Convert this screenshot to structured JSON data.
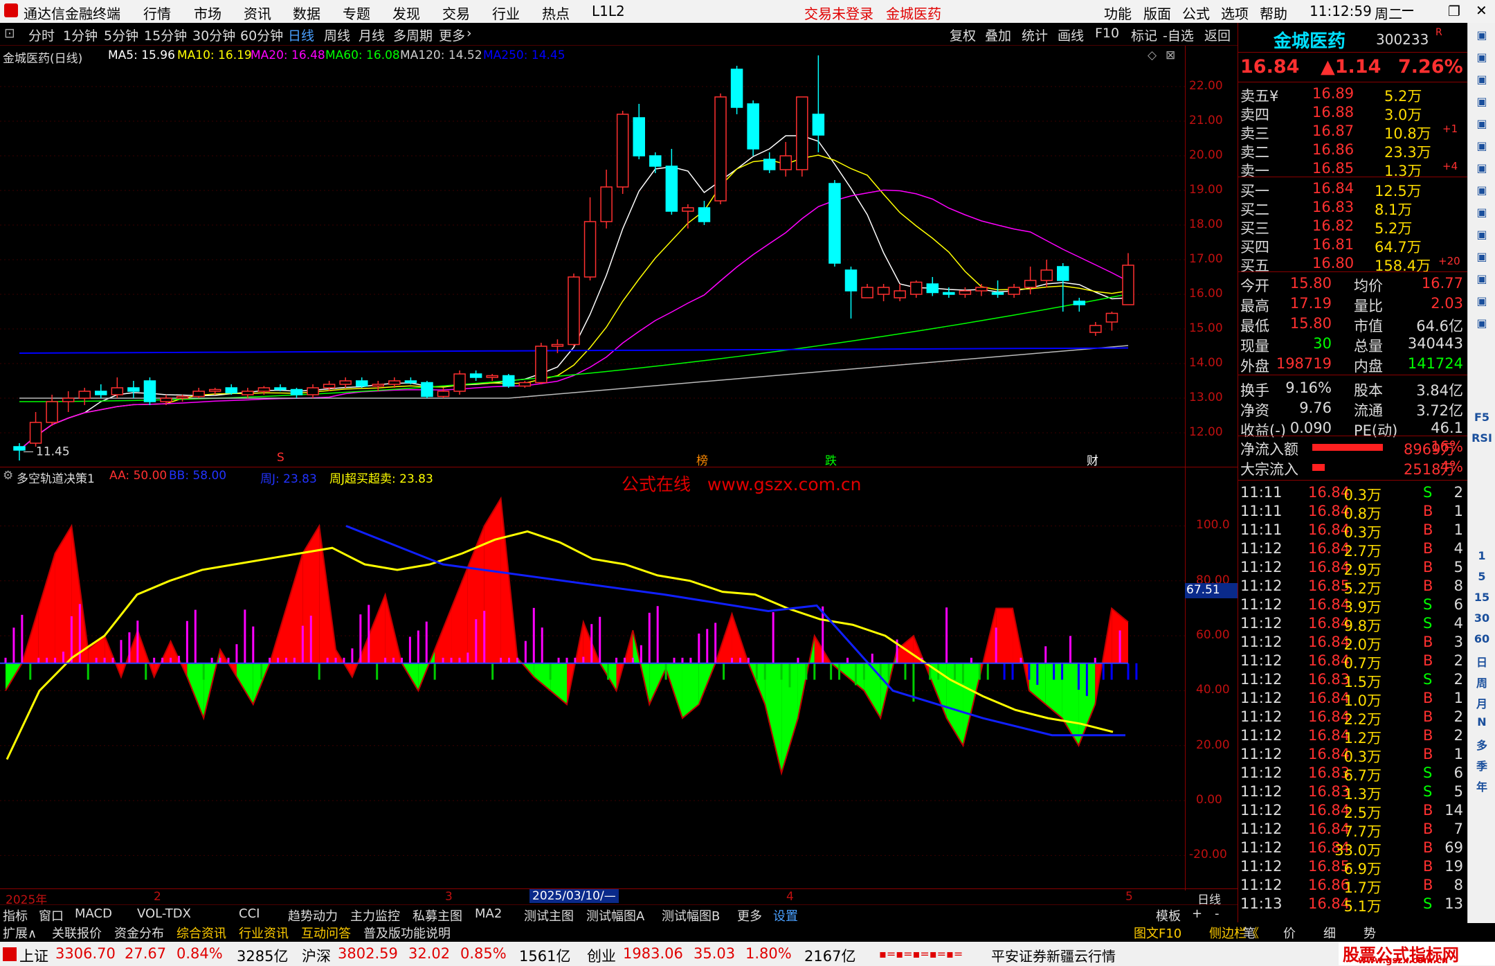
{
  "app": {
    "title": "通达信金融终端",
    "trade_status": "交易未登录",
    "stock_title": "金城医药",
    "func_menu": [
      "功能",
      "版面",
      "公式",
      "选项",
      "帮助"
    ],
    "clock": "11:12:59",
    "weekday": "周二"
  },
  "menu": [
    "行情",
    "市场",
    "资讯",
    "数据",
    "专题",
    "发现",
    "交易",
    "行业",
    "热点",
    "L1L2"
  ],
  "toolbar": {
    "periods": [
      "分时",
      "1分钟",
      "5分钟",
      "15分钟",
      "30分钟",
      "60分钟",
      "日线",
      "周线",
      "月线",
      "多周期",
      "更多"
    ],
    "active": "日线",
    "right": [
      "复权",
      "叠加",
      "统计",
      "画线",
      "F10",
      "标记",
      "-自选",
      "返回"
    ]
  },
  "ma_line": {
    "name": "金城医药(日线)",
    "items": [
      {
        "label": "MA5: 15.96",
        "color": "#ffffff"
      },
      {
        "label": "MA10: 16.19",
        "color": "#ffff00"
      },
      {
        "label": "MA20: 16.48",
        "color": "#ff00ff"
      },
      {
        "label": "MA60: 16.08",
        "color": "#00ff00"
      },
      {
        "label": "MA120: 14.52",
        "color": "#cccccc"
      },
      {
        "label": "MA250: 14.45",
        "color": "#0000ff"
      }
    ]
  },
  "price_axis": [
    "22.00",
    "21.00",
    "20.00",
    "19.00",
    "18.00",
    "17.00",
    "16.00",
    "15.00",
    "14.00",
    "13.00",
    "12.00"
  ],
  "price_marks": {
    "high": "23.22",
    "low": "11.45"
  },
  "event_marks": [
    {
      "t": "S",
      "color": "#ff3030"
    },
    {
      "t": "榜",
      "color": "#ff8a00"
    },
    {
      "t": "跌",
      "color": "#00ff00"
    },
    {
      "t": "财",
      "color": "#ffffff"
    }
  ],
  "indicator": {
    "name": "多空轨道决策1",
    "items": [
      {
        "label": "AA: 50.00",
        "color": "#ff3030"
      },
      {
        "label": "BB: 58.00",
        "color": "#0000ff"
      },
      {
        "label": "周J: 23.83",
        "color": "#0000ff"
      },
      {
        "label": "周J超买超卖: 23.83",
        "color": "#ffff00"
      }
    ],
    "watermark": "公式在线   www.gszx.com.cn",
    "axis": [
      "100.0",
      "80.00",
      "60.00",
      "40.00",
      "20.00",
      "0.00",
      "-20.00"
    ],
    "cursor_value": "67.51"
  },
  "date_axis": [
    "2025年",
    "2",
    "3",
    "2025/03/10/—",
    "4",
    "5",
    "日线"
  ],
  "tabs1": [
    "指标",
    "窗口",
    "MACD",
    "VOL-TDX",
    "CCI",
    "趋势动力",
    "主力监控",
    "私募主图",
    "MA2",
    "测试主图",
    "测试幅图A",
    "测试幅图B",
    "更多",
    "设置",
    "模板",
    "+",
    "-"
  ],
  "tabs2": [
    "扩展∧",
    "关联报价",
    "资金分布",
    "综合资讯",
    "行业资讯",
    "互动问答",
    "普及版功能说明",
    "图文F10",
    "侧边栏《",
    "笔",
    "价",
    "细",
    "势"
  ],
  "quote": {
    "name": "金城医药",
    "code": "300233",
    "r": "R",
    "price": "16.84",
    "change": "▲1.14",
    "pct": "7.26%"
  },
  "orderbook": {
    "asks": [
      {
        "l": "卖五¥",
        "p": "16.89",
        "v": "5.2万",
        "d": ""
      },
      {
        "l": "卖四",
        "p": "16.88",
        "v": "3.0万",
        "d": ""
      },
      {
        "l": "卖三",
        "p": "16.87",
        "v": "10.8万",
        "d": "+1"
      },
      {
        "l": "卖二",
        "p": "16.86",
        "v": "23.3万",
        "d": ""
      },
      {
        "l": "卖一",
        "p": "16.85",
        "v": "1.3万",
        "d": "+4"
      }
    ],
    "bids": [
      {
        "l": "买一",
        "p": "16.84",
        "v": "12.5万",
        "d": ""
      },
      {
        "l": "买二",
        "p": "16.83",
        "v": "8.1万",
        "d": ""
      },
      {
        "l": "买三",
        "p": "16.82",
        "v": "5.2万",
        "d": ""
      },
      {
        "l": "买四",
        "p": "16.81",
        "v": "64.7万",
        "d": ""
      },
      {
        "l": "买五",
        "p": "16.80",
        "v": "158.4万",
        "d": "+20"
      }
    ]
  },
  "stats": [
    [
      "今开",
      "15.80",
      "均价",
      "16.77"
    ],
    [
      "最高",
      "17.19",
      "量比",
      "2.03"
    ],
    [
      "最低",
      "15.80",
      "市值",
      "64.6亿"
    ],
    [
      "现量",
      "30",
      "总量",
      "340443"
    ],
    [
      "外盘",
      "198719",
      "内盘",
      "141724"
    ],
    [
      "换手",
      "9.16%",
      "股本",
      "3.84亿"
    ],
    [
      "净资",
      "9.76",
      "流通",
      "3.72亿"
    ],
    [
      "收益(-)",
      "0.090",
      "PE(动)",
      "46.1"
    ]
  ],
  "flows": [
    {
      "l": "净流入额",
      "v": "8969万",
      "p": "16%",
      "bar": 0.85
    },
    {
      "l": "大宗流入",
      "v": "2518万",
      "p": "4%",
      "bar": 0.15
    }
  ],
  "ticks": [
    [
      "11:11",
      "16.84",
      "0.3万",
      "S",
      "2"
    ],
    [
      "11:11",
      "16.84",
      "0.8万",
      "B",
      "1"
    ],
    [
      "11:11",
      "16.84",
      "0.3万",
      "B",
      "1"
    ],
    [
      "11:12",
      "16.84",
      "2.7万",
      "B",
      "4"
    ],
    [
      "11:12",
      "16.84",
      "2.9万",
      "B",
      "5"
    ],
    [
      "11:12",
      "16.85",
      "5.2万",
      "B",
      "8"
    ],
    [
      "11:12",
      "16.84",
      "3.9万",
      "S",
      "6"
    ],
    [
      "11:12",
      "16.84",
      "9.8万",
      "S",
      "4"
    ],
    [
      "11:12",
      "16.84",
      "2.0万",
      "B",
      "3"
    ],
    [
      "11:12",
      "16.84",
      "0.7万",
      "B",
      "2"
    ],
    [
      "11:12",
      "16.83",
      "1.5万",
      "S",
      "2"
    ],
    [
      "11:12",
      "16.84",
      "1.0万",
      "B",
      "1"
    ],
    [
      "11:12",
      "16.84",
      "2.2万",
      "B",
      "2"
    ],
    [
      "11:12",
      "16.84",
      "1.2万",
      "B",
      "2"
    ],
    [
      "11:12",
      "16.84",
      "0.3万",
      "B",
      "1"
    ],
    [
      "11:12",
      "16.83",
      "6.7万",
      "S",
      "6"
    ],
    [
      "11:12",
      "16.83",
      "1.3万",
      "S",
      "5"
    ],
    [
      "11:12",
      "16.84",
      "2.5万",
      "B",
      "14"
    ],
    [
      "11:12",
      "16.84",
      "7.7万",
      "B",
      "7"
    ],
    [
      "11:12",
      "16.84",
      "33.0万",
      "B",
      "69"
    ],
    [
      "11:12",
      "16.85",
      "6.9万",
      "B",
      "19"
    ],
    [
      "11:12",
      "16.86",
      "1.7万",
      "B",
      "8"
    ],
    [
      "11:13",
      "16.84",
      "5.1万",
      "S",
      "13"
    ]
  ],
  "status": {
    "idx": [
      {
        "n": "上证",
        "v": "3306.70",
        "c": "27.67",
        "p": "0.84%",
        "a": "3285亿"
      },
      {
        "n": "沪深",
        "v": "3802.59",
        "c": "32.02",
        "p": "0.85%",
        "a": "1561亿"
      },
      {
        "n": "创业",
        "v": "1983.06",
        "c": "35.03",
        "p": "1.80%",
        "a": "2167亿"
      }
    ],
    "server": "平安证券新疆云行情",
    "brand": "股票公式指标网",
    "brand_url": "www.gszx.com.cn"
  },
  "side_icons": [
    "1",
    "5",
    "15",
    "30",
    "60",
    "日",
    "周",
    "月",
    "N",
    "多",
    "季",
    "年",
    "F5",
    "RSI"
  ]
}
